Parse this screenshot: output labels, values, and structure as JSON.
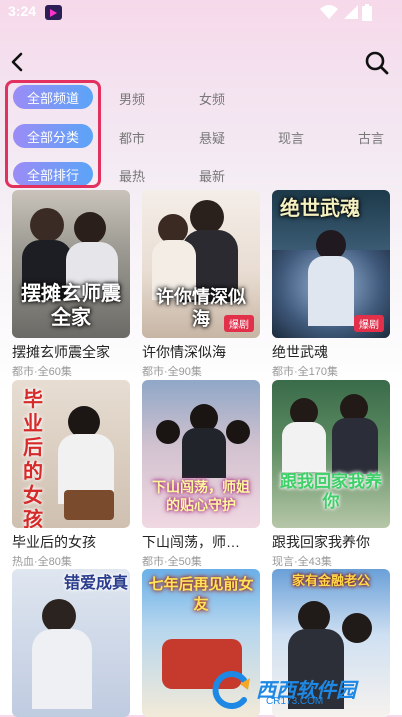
{
  "status": {
    "time": "3:24"
  },
  "filters": {
    "channel": {
      "active": "全部频道",
      "options": [
        "男频",
        "女频"
      ]
    },
    "category": {
      "active": "全部分类",
      "options": [
        "都市",
        "悬疑",
        "现言",
        "古言"
      ]
    },
    "ranking": {
      "active": "全部排行",
      "options": [
        "最热",
        "最新"
      ]
    }
  },
  "cards": [
    {
      "title": "摆摊玄师震全家",
      "meta": "都市·全60集",
      "poster_text": "摆摊玄师震全家",
      "badge": ""
    },
    {
      "title": "许你情深似海",
      "meta": "都市·全90集",
      "poster_text": "许你情深似海",
      "badge": "爆剧"
    },
    {
      "title": "绝世武魂",
      "meta": "都市·全170集",
      "poster_text": "绝世武魂",
      "badge": "爆剧"
    },
    {
      "title": "毕业后的女孩",
      "meta": "热血·全80集",
      "poster_text": "毕业后的女孩",
      "badge": ""
    },
    {
      "title": "下山闯荡，师…",
      "meta": "都市·全50集",
      "poster_text": "下山闯荡，师姐的贴心守护",
      "badge": ""
    },
    {
      "title": "跟我回家我养你",
      "meta": "现言·全43集",
      "poster_text": "跟我回家我养你",
      "badge": ""
    },
    {
      "title": "",
      "meta": "",
      "poster_text": "错爱成真",
      "badge": ""
    },
    {
      "title": "",
      "meta": "",
      "poster_text": "七年后再见前女友",
      "badge": ""
    },
    {
      "title": "",
      "meta": "",
      "poster_text": "家有金融老公",
      "badge": ""
    }
  ],
  "watermark": {
    "text": "西西软件园",
    "sub": "CR173.COM"
  }
}
